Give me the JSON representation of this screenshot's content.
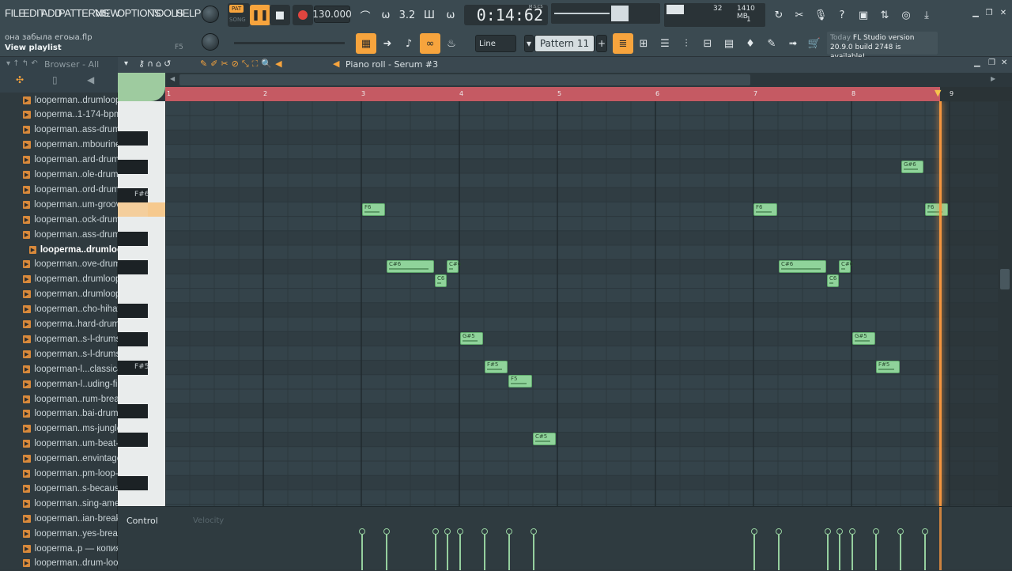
{
  "menu": [
    "FILE",
    "EDIT",
    "ADD",
    "PATTERNS",
    "VIEW",
    "OPTIONS",
    "TOOLS",
    "HELP"
  ],
  "transport": {
    "pat": "PAT",
    "song": "SONG",
    "tempo": "130.000",
    "time": "0:14:62",
    "time_label": "M:S:CS"
  },
  "cpu": {
    "value": "32",
    "memory": "1410 MB",
    "poly": "1"
  },
  "hint": {
    "line1": "она забыла егоыа.flp",
    "line2": "View playlist",
    "key": "F5"
  },
  "toolbar": {
    "snap": "Line",
    "pattern": "Pattern 11",
    "news_line1_a": "Today",
    "news_line1_b": "FL Studio version",
    "news_line2": "20.9.0 build 2748 is available!"
  },
  "browser": {
    "title": "Browser - All",
    "items": [
      "looperman..drumloop",
      "looperma..1-174-bpm",
      "looperman..ass-drums",
      "looperman..mbourine",
      "looperman..ard-drums",
      "looperman..ole-drums",
      "looperman..ord-drums",
      "looperman..um-groove",
      "looperman..ock-drums",
      "looperman..ass-drums",
      "looperma..drumloop",
      "looperman..ove-drums",
      "looperman..drumloop",
      "looperman..drumloop",
      "looperman..cho-hihat",
      "looperma..hard-drum",
      "looperman..s-l-drums",
      "looperman..s-l-drums",
      "looperman-l...classical",
      "looperman-l..uding-fill",
      "looperman..rum-break",
      "looperman..bai-drums",
      "looperman..ms-jungle",
      "looperman..um-beat-1",
      "looperman..envintage",
      "looperman..pm-loop-2",
      "looperman..s-because",
      "looperman..sing-amen",
      "looperman..ian-break",
      "looperman..yes-break",
      "looperma..p — копия",
      "looperman..drum-loop"
    ]
  },
  "piano_roll": {
    "title": "Piano roll - Serum #3",
    "bars": [
      "1",
      "2",
      "3",
      "4",
      "5",
      "6",
      "7",
      "8",
      "9"
    ],
    "key_labels": [
      "F#6",
      "F#5"
    ],
    "notes": [
      {
        "label": "G#6"
      },
      {
        "label": "F6"
      },
      {
        "label": "F6"
      },
      {
        "label": "F6"
      },
      {
        "label": "C#6"
      },
      {
        "label": "C#6"
      },
      {
        "label": "C6"
      },
      {
        "label": "C#6"
      },
      {
        "label": "C#6"
      },
      {
        "label": "C6"
      },
      {
        "label": "G#5"
      },
      {
        "label": "G#5"
      },
      {
        "label": "F#5"
      },
      {
        "label": "F#5"
      },
      {
        "label": "F5"
      },
      {
        "label": "C#5"
      }
    ],
    "control_label": "Control",
    "control_sub": "Velocity"
  }
}
